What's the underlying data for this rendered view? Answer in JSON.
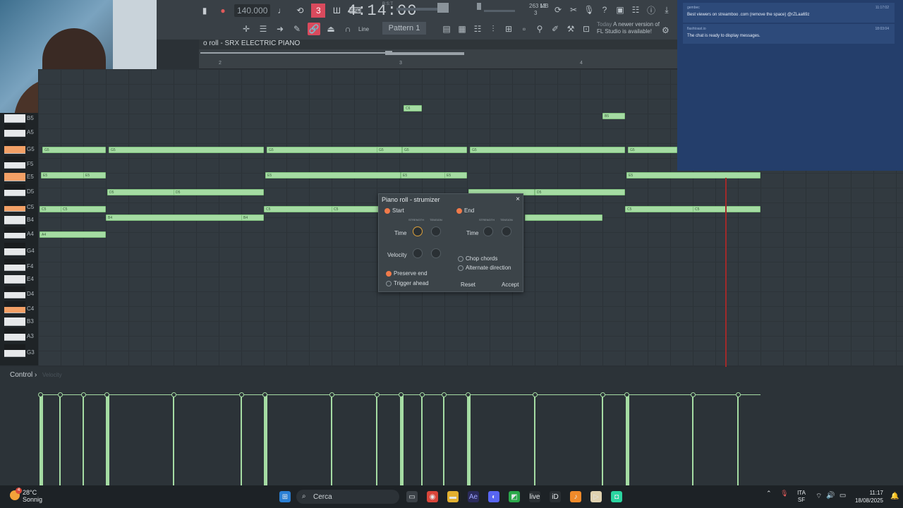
{
  "toolbar": {
    "tempo": "140.000",
    "clock": "4:14:00",
    "clock_sub": "B:S:T",
    "mem_top": "13",
    "mem_mb": "263 MB",
    "mem_bot": "3",
    "pattern": "Pattern 1",
    "snap": "Line",
    "hint_title": "Today",
    "hint_text": "A newer version of FL Studio is available!"
  },
  "piano_roll": {
    "title": "o roll - SRX ELECTRIC PIANO",
    "bars": [
      "2",
      "3",
      "4"
    ]
  },
  "keys": [
    {
      "n": "B5"
    },
    {
      "n": "A5"
    },
    {
      "n": "G5"
    },
    {
      "n": "F5"
    },
    {
      "n": "E5"
    },
    {
      "n": "D5"
    },
    {
      "n": "C5"
    },
    {
      "n": "B4"
    },
    {
      "n": "A4"
    },
    {
      "n": "G4"
    },
    {
      "n": "F4"
    },
    {
      "n": "E4"
    },
    {
      "n": "D4"
    },
    {
      "n": "C4"
    },
    {
      "n": "B3"
    },
    {
      "n": "A3"
    },
    {
      "n": "G3"
    }
  ],
  "notes": [
    {
      "label": "C6"
    },
    {
      "label": "B5"
    },
    {
      "label": "G5"
    },
    {
      "label": "G5"
    },
    {
      "label": "G5"
    },
    {
      "label": "G5"
    },
    {
      "label": "G5"
    },
    {
      "label": "G5"
    },
    {
      "label": "G5"
    },
    {
      "label": "E5"
    },
    {
      "label": "E5"
    },
    {
      "label": "E5"
    },
    {
      "label": "E5"
    },
    {
      "label": "E5"
    },
    {
      "label": "E5"
    },
    {
      "label": "D5"
    },
    {
      "label": "D5"
    },
    {
      "label": "D5"
    },
    {
      "label": ""
    },
    {
      "label": "C5"
    },
    {
      "label": "C5"
    },
    {
      "label": "C5"
    },
    {
      "label": "C5"
    },
    {
      "label": "C5"
    },
    {
      "label": "C5"
    },
    {
      "label": "B4"
    },
    {
      "label": "B4"
    },
    {
      "label": ""
    },
    {
      "label": "A4"
    }
  ],
  "strumizer": {
    "title": "Piano roll - strumizer",
    "close": "×",
    "start": "Start",
    "end": "End",
    "strength": "STRENGTH",
    "tension": "TENSION",
    "time": "Time",
    "time_end": "Time",
    "velocity": "Velocity",
    "preserve_end": "Preserve end",
    "trigger_ahead": "Trigger ahead",
    "chop_chords": "Chop chords",
    "alternate_direction": "Alternate direction",
    "reset": "Reset",
    "accept": "Accept"
  },
  "control": {
    "label": "Control ›",
    "sub": "Velocity"
  },
  "chat": {
    "messages": [
      {
        "user": "gembec",
        "text": "Best viewers on streamboo .com (remove the space) @rZLaa69z",
        "time": "11:17:02"
      },
      {
        "user": "flashtoast.io",
        "text": "The chat is ready to display messages.",
        "time": "18:03:04"
      }
    ]
  },
  "taskbar": {
    "temp": "28°C",
    "weather": "Sonnig",
    "search": "Cerca",
    "lang_top": "ITA",
    "lang_bot": "SF",
    "time": "11:17",
    "date": "18/08/2025",
    "weather_badge": "4"
  },
  "colors": {
    "note": "#a5dca3",
    "accent": "#d94a5d",
    "playhead": "#a02a2a",
    "chat_bg": "#243e6b"
  }
}
